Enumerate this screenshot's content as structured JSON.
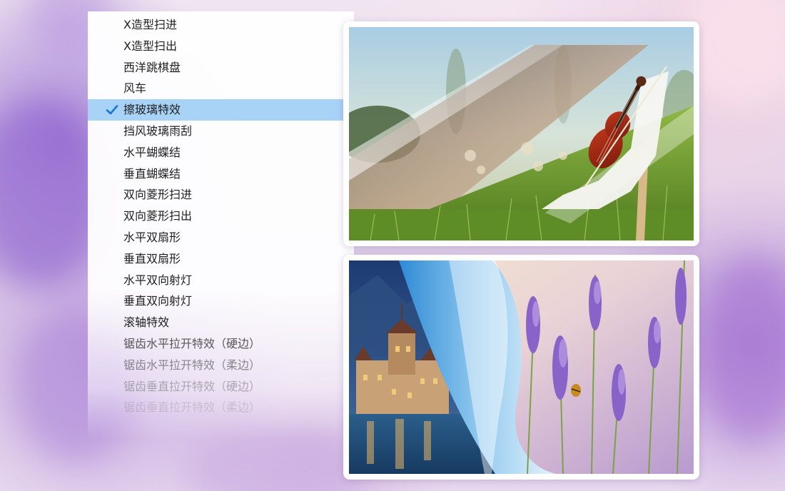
{
  "effects_menu": {
    "items": [
      {
        "label": "X造型扫进",
        "selected": false
      },
      {
        "label": "X造型扫出",
        "selected": false
      },
      {
        "label": "西洋跳棋盘",
        "selected": false
      },
      {
        "label": "风车",
        "selected": false
      },
      {
        "label": "擦玻璃特效",
        "selected": true
      },
      {
        "label": "挡风玻璃雨刮",
        "selected": false
      },
      {
        "label": "水平蝴蝶结",
        "selected": false
      },
      {
        "label": "垂直蝴蝶结",
        "selected": false
      },
      {
        "label": "双向菱形扫进",
        "selected": false
      },
      {
        "label": "双向菱形扫出",
        "selected": false
      },
      {
        "label": "水平双扇形",
        "selected": false
      },
      {
        "label": "垂直双扇形",
        "selected": false
      },
      {
        "label": "水平双向射灯",
        "selected": false
      },
      {
        "label": "垂直双向射灯",
        "selected": false
      },
      {
        "label": "滚轴特效",
        "selected": false
      },
      {
        "label": "锯齿水平拉开特效（硬边）",
        "selected": false
      },
      {
        "label": "锯齿水平拉开特效（柔边）",
        "selected": false
      },
      {
        "label": "锯齿垂直拉开特效（硬边）",
        "selected": false
      },
      {
        "label": "锯齿垂直拉开特效（柔边）",
        "selected": false
      }
    ],
    "check_icon": "checkmark-icon"
  },
  "previews": {
    "top": {
      "subject": "violin-on-grass-with-diagonal-wipe"
    },
    "bottom": {
      "subject": "castle-by-lake-and-lavender-with-page-curl"
    }
  },
  "colors": {
    "selection": "#a9d2f7",
    "check": "#1a73d9",
    "panel": "#ffffff",
    "backdrop": "#e9ddef"
  }
}
